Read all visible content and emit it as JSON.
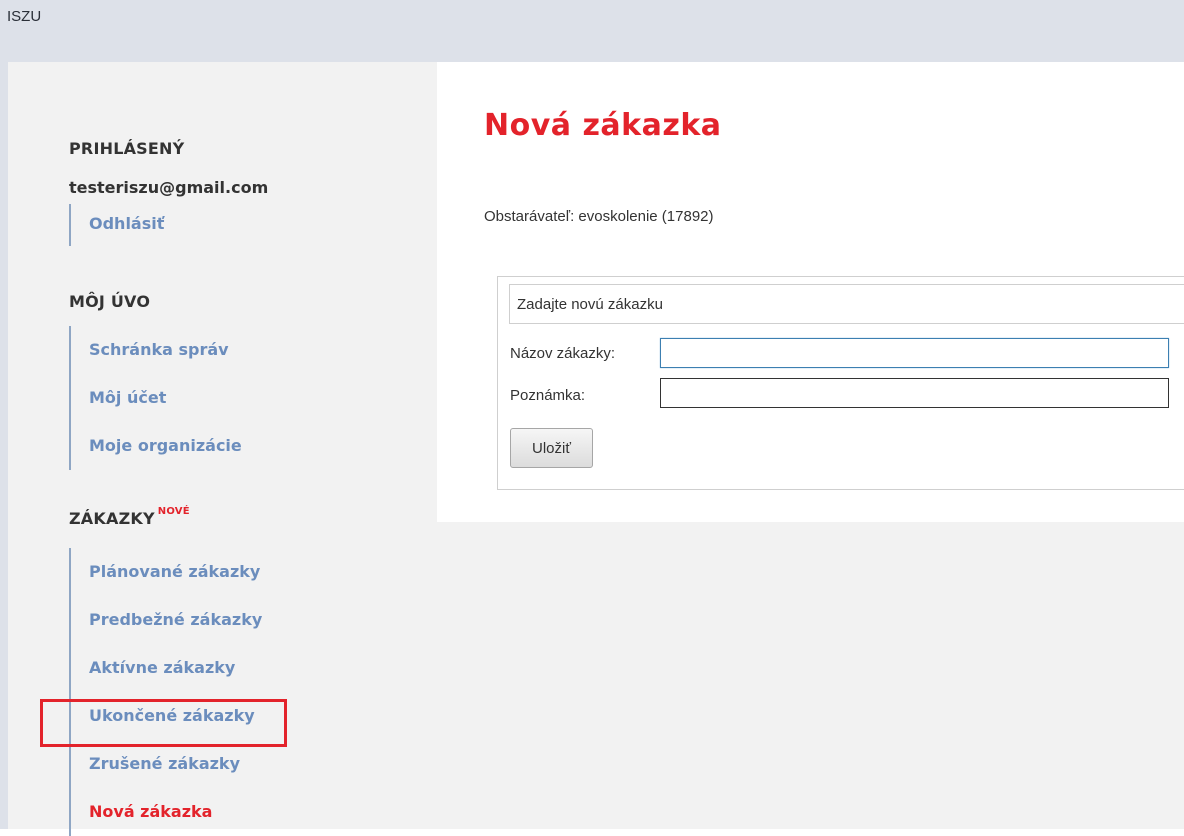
{
  "app": {
    "title": "ISZU"
  },
  "sidebar": {
    "logged_in": {
      "heading": "PRIHLÁSENÝ",
      "email": "testeriszu@gmail.com",
      "logout_label": "Odhlásiť"
    },
    "my_uvo": {
      "heading": "MÔJ ÚVO",
      "items": [
        {
          "label": "Schránka správ"
        },
        {
          "label": "Môj účet"
        },
        {
          "label": "Moje organizácie"
        }
      ]
    },
    "contracts": {
      "heading": "ZÁKAZKY",
      "badge": "NOVÉ",
      "items": [
        {
          "label": "Plánované zákazky"
        },
        {
          "label": "Predbežné zákazky"
        },
        {
          "label": "Aktívne zákazky"
        },
        {
          "label": "Ukončené zákazky"
        },
        {
          "label": "Zrušené zákazky"
        },
        {
          "label": "Nová zákazka",
          "active": true
        }
      ]
    }
  },
  "main": {
    "title": "Nová zákazka",
    "contracting_authority": "Obstarávateľ: evoskolenie (17892)",
    "form": {
      "legend": "Zadajte novú zákazku",
      "name_label": "Názov zákazky:",
      "name_value": "",
      "note_label": "Poznámka:",
      "note_value": "",
      "save_label": "Uložiť"
    }
  },
  "colors": {
    "accent_red": "#e3232b",
    "link_blue": "#6b8dbd",
    "sidebar_bg": "#f2f2f2",
    "header_bg": "#dde1e9"
  }
}
